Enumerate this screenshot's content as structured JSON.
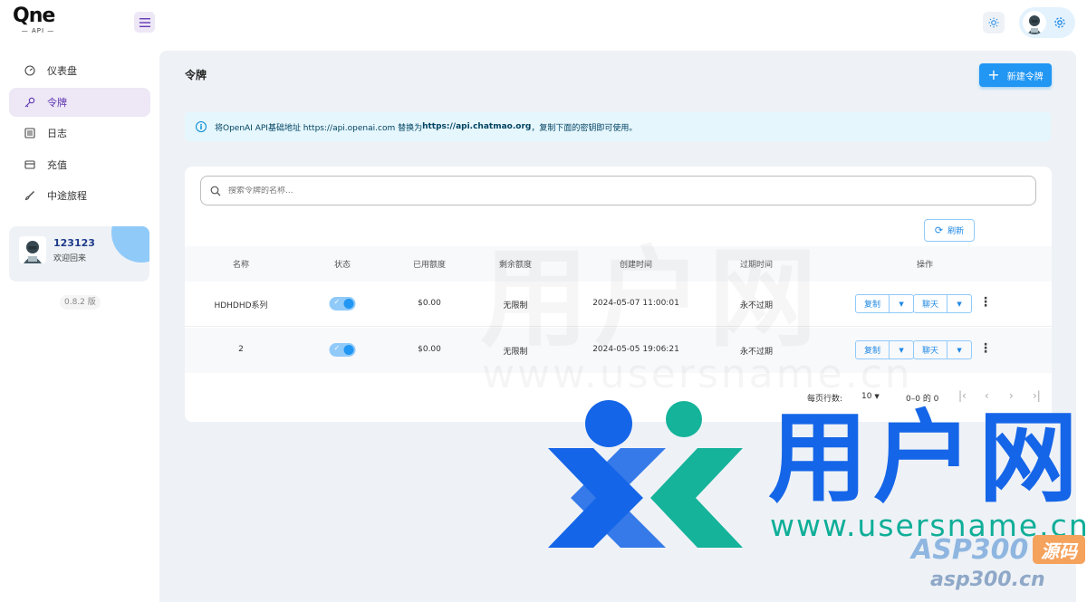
{
  "app": {
    "logo_main": "Qne",
    "logo_sub": "— API —"
  },
  "sidebar": {
    "items": [
      {
        "label": "仪表盘",
        "icon": "dashboard-icon"
      },
      {
        "label": "令牌",
        "icon": "key-icon"
      },
      {
        "label": "日志",
        "icon": "log-icon"
      },
      {
        "label": "充值",
        "icon": "card-icon"
      },
      {
        "label": "中途旅程",
        "icon": "brush-icon"
      }
    ],
    "user": {
      "name": "123123",
      "welcome": "欢迎回来"
    },
    "version": "0.8.2 版"
  },
  "page": {
    "title": "令牌",
    "new_button": "新建令牌",
    "alert": {
      "prefix": "将OpenAI API基础地址 https://api.openai.com 替换为 ",
      "bold": "https://api.chatmao.org",
      "suffix": "，复制下面的密钥即可使用。"
    },
    "search_placeholder": "搜索令牌的名称...",
    "refresh_button": "刷新"
  },
  "table": {
    "headers": [
      "名称",
      "状态",
      "已用额度",
      "剩余额度",
      "创建时间",
      "过期时间",
      "操作"
    ],
    "rows": [
      {
        "name": "HDHDHD系列",
        "enabled": true,
        "used": "$0.00",
        "remaining": "无限制",
        "created": "2024-05-07 11:00:01",
        "expires": "永不过期",
        "copy": "复制",
        "chat": "聊天"
      },
      {
        "name": "2",
        "enabled": true,
        "used": "$0.00",
        "remaining": "无限制",
        "created": "2024-05-05 19:06:21",
        "expires": "永不过期",
        "copy": "复制",
        "chat": "聊天"
      }
    ]
  },
  "pagination": {
    "rows_per_page_label": "每页行数:",
    "rows_per_page": "10",
    "range": "0–0 的 0"
  },
  "watermark": {
    "cn": "用户网",
    "url": "www.usersname.cn",
    "asp": "ASP300",
    "asp_badge": "源码",
    "asp_url": "asp300.cn"
  },
  "colors": {
    "primary": "#2196f3",
    "accent_purple": "#5e35b1",
    "alert_bg": "#e5f6fd",
    "main_bg": "#eef2f6"
  }
}
